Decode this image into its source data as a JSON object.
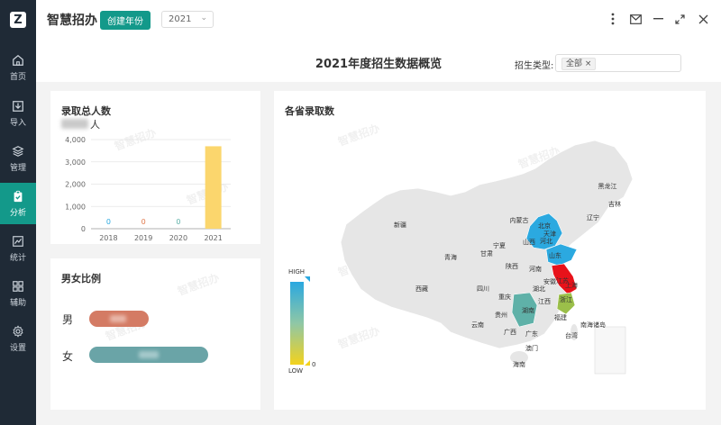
{
  "sidebar": {
    "items": [
      {
        "label": "首页",
        "icon": "home-icon"
      },
      {
        "label": "导入",
        "icon": "import-icon"
      },
      {
        "label": "管理",
        "icon": "layers-icon"
      },
      {
        "label": "分析",
        "icon": "clipboard-icon"
      },
      {
        "label": "统计",
        "icon": "line-chart-icon"
      },
      {
        "label": "辅助",
        "icon": "grid-icon"
      },
      {
        "label": "设置",
        "icon": "gear-icon"
      }
    ],
    "active": "分析"
  },
  "header": {
    "title": "智慧招办",
    "create_button": "创建年份",
    "year_value": "2021"
  },
  "page": {
    "title": "2021年度招生数据概览",
    "filter_label": "招生类型:",
    "filter_tag": "全部",
    "tag_close": "×"
  },
  "total_card": {
    "title": "录取总人数",
    "unit": "人"
  },
  "gender_card": {
    "title": "男女比例",
    "male": "男",
    "female": "女"
  },
  "map_card": {
    "title": "各省录取数",
    "legend_high": "HIGH",
    "legend_low": "LOW",
    "legend_zero": "0",
    "provinces": [
      {
        "name": "黑龙江",
        "color": "#e6e6e6"
      },
      {
        "name": "吉林",
        "color": "#e6e6e6"
      },
      {
        "name": "辽宁",
        "color": "#e6e6e6"
      },
      {
        "name": "内蒙古",
        "color": "#e6e6e6"
      },
      {
        "name": "新疆",
        "color": "#e6e6e6"
      },
      {
        "name": "宁夏",
        "color": "#e6e6e6"
      },
      {
        "name": "山西",
        "color": "#2ba9e0"
      },
      {
        "name": "河北",
        "color": "#2ba9e0"
      },
      {
        "name": "北京",
        "color": "#2ba9e0"
      },
      {
        "name": "天津",
        "color": "#2ba9e0"
      },
      {
        "name": "青海",
        "color": "#e6e6e6"
      },
      {
        "name": "甘肃",
        "color": "#e6e6e6"
      },
      {
        "name": "山东",
        "color": "#2ba9e0"
      },
      {
        "name": "陕西",
        "color": "#e6e6e6"
      },
      {
        "name": "河南",
        "color": "#e6e6e6"
      },
      {
        "name": "江苏",
        "color": "#e8121a"
      },
      {
        "name": "安徽",
        "color": "#e6e6e6"
      },
      {
        "name": "上海",
        "color": "#e8121a"
      },
      {
        "name": "西藏",
        "color": "#e6e6e6"
      },
      {
        "name": "四川",
        "color": "#e6e6e6"
      },
      {
        "name": "湖北",
        "color": "#e6e6e6"
      },
      {
        "name": "重庆",
        "color": "#e6e6e6"
      },
      {
        "name": "浙江",
        "color": "#9bbf4a"
      },
      {
        "name": "江西",
        "color": "#e6e6e6"
      },
      {
        "name": "湖南",
        "color": "#5fb1a8"
      },
      {
        "name": "贵州",
        "color": "#e6e6e6"
      },
      {
        "name": "福建",
        "color": "#e6e6e6"
      },
      {
        "name": "云南",
        "color": "#e6e6e6"
      },
      {
        "name": "南海诸岛",
        "color": "#e6e6e6"
      },
      {
        "name": "广西",
        "color": "#e6e6e6"
      },
      {
        "name": "广东",
        "color": "#e6e6e6"
      },
      {
        "name": "台湾",
        "color": "#e6e6e6"
      },
      {
        "name": "澳门",
        "color": "#e6e6e6"
      },
      {
        "name": "海南",
        "color": "#e6e6e6"
      }
    ]
  },
  "watermark_text": "智慧招办",
  "colors": {
    "accent": "#13998a",
    "sidebar": "#1f2a36",
    "male": "#d47b64",
    "female": "#6aa4a7",
    "bar": "#fbd66d"
  },
  "chart_data": {
    "type": "bar",
    "categories": [
      "2018",
      "2019",
      "2020",
      "2021"
    ],
    "values": [
      0,
      0,
      0,
      3700
    ],
    "data_labels": [
      "0",
      "0",
      "0",
      ""
    ],
    "ylim": [
      0,
      4000
    ],
    "yticks": [
      "0",
      "1,000",
      "2,000",
      "3,000",
      "4,000"
    ],
    "grid": true,
    "label_colors": [
      "#2ba9e0",
      "#e07a4d",
      "#5fb1a8",
      ""
    ]
  }
}
